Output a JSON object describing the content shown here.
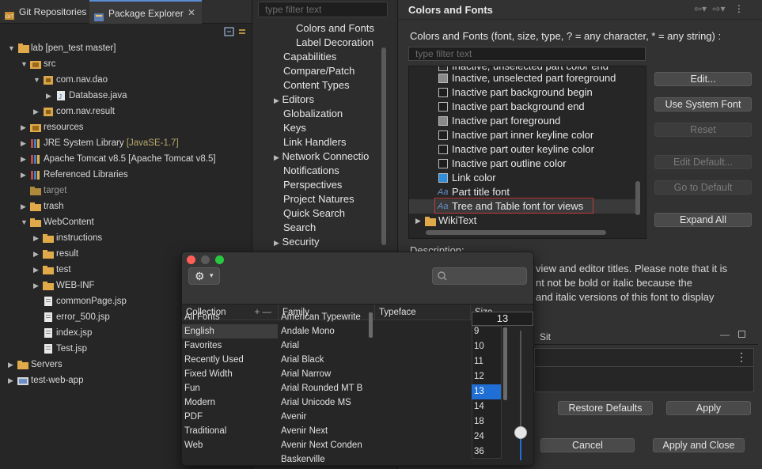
{
  "left": {
    "tabs": [
      {
        "label": "Git Repositories"
      },
      {
        "label": "Package Explorer"
      }
    ],
    "tree": [
      {
        "label": "lab [pen_test master]"
      },
      {
        "label": "src"
      },
      {
        "label": "com.nav.dao"
      },
      {
        "label": "Database.java"
      },
      {
        "label": "com.nav.result"
      },
      {
        "label": "resources"
      },
      {
        "label": "JRE System Library",
        "extra": "[JavaSE-1.7]"
      },
      {
        "label": "Apache Tomcat v8.5 [Apache Tomcat v8.5]"
      },
      {
        "label": "Referenced Libraries"
      },
      {
        "label": "target"
      },
      {
        "label": "trash"
      },
      {
        "label": "WebContent"
      },
      {
        "label": "instructions"
      },
      {
        "label": "result"
      },
      {
        "label": "test"
      },
      {
        "label": "WEB-INF"
      },
      {
        "label": "commonPage.jsp"
      },
      {
        "label": "error_500.jsp"
      },
      {
        "label": "index.jsp"
      },
      {
        "label": "Test.jsp"
      },
      {
        "label": "Servers"
      },
      {
        "label": "test-web-app"
      }
    ]
  },
  "prefs": {
    "filter_placeholder": "type filter text",
    "items": [
      {
        "label": "Colors and Fonts"
      },
      {
        "label": "Label Decoration"
      },
      {
        "label": "Capabilities"
      },
      {
        "label": "Compare/Patch"
      },
      {
        "label": "Content Types"
      },
      {
        "label": "Editors"
      },
      {
        "label": "Globalization"
      },
      {
        "label": "Keys"
      },
      {
        "label": "Link Handlers"
      },
      {
        "label": "Network Connectio"
      },
      {
        "label": "Notifications"
      },
      {
        "label": "Perspectives"
      },
      {
        "label": "Project Natures"
      },
      {
        "label": "Quick Search"
      },
      {
        "label": "Search"
      },
      {
        "label": "Security"
      }
    ]
  },
  "colors_fonts": {
    "title": "Colors and Fonts",
    "description": "Colors and Fonts (font, size, type, ? = any character, * = any string) :",
    "filter_placeholder": "type filter text",
    "partial_top": "Inactive, unselected part color end",
    "rows": [
      {
        "label": "Inactive, unselected part foreground"
      },
      {
        "label": "Inactive part background begin"
      },
      {
        "label": "Inactive part background end"
      },
      {
        "label": "Inactive part foreground"
      },
      {
        "label": "Inactive part inner keyline color"
      },
      {
        "label": "Inactive part outer keyline color"
      },
      {
        "label": "Inactive part outline color"
      },
      {
        "label": "Link color"
      },
      {
        "label": "Part title font"
      },
      {
        "label": "Tree and Table font for views"
      },
      {
        "label": "WikiText"
      }
    ],
    "buttons": {
      "edit": "Edit...",
      "use_system_font": "Use System Font",
      "reset": "Reset",
      "edit_default": "Edit Default...",
      "go_to_default": "Go to Default",
      "expand_all": "Expand All"
    },
    "description_label": "Description:",
    "description_lines": [
      "view and editor titles. Please note that it is",
      "nt not be bold or italic because the",
      "and italic versions of this font to display"
    ],
    "preview_tab": "Sit",
    "footer": {
      "restore_defaults": "Restore Defaults",
      "apply": "Apply",
      "cancel": "Cancel",
      "apply_close": "Apply and Close"
    }
  },
  "fonts_dialog": {
    "headers": {
      "collection": "Collection",
      "family": "Family",
      "typeface": "Typeface",
      "size": "Size"
    },
    "collections": [
      "All Fonts",
      "English",
      "Favorites",
      "Recently Used",
      "Fixed Width",
      "Fun",
      "Modern",
      "PDF",
      "Traditional",
      "Web"
    ],
    "selected_collection": "English",
    "families": [
      "American Typewrite",
      "Andale Mono",
      "Arial",
      "Arial Black",
      "Arial Narrow",
      "Arial Rounded MT B",
      "Arial Unicode MS",
      "Avenir",
      "Avenir Next",
      "Avenir Next Conden",
      "Baskerville"
    ],
    "size_value": "13",
    "sizes": [
      "9",
      "10",
      "11",
      "12",
      "13",
      "14",
      "18",
      "24",
      "36"
    ],
    "selected_size": "13",
    "slider_level": 0.18
  },
  "colors": {
    "accent_blue": "#1f6fd6",
    "highlight_red": "#c03b3b",
    "traffic_close": "#ff5f57",
    "traffic_min": "#5a5a5a",
    "traffic_max": "#28c840"
  }
}
